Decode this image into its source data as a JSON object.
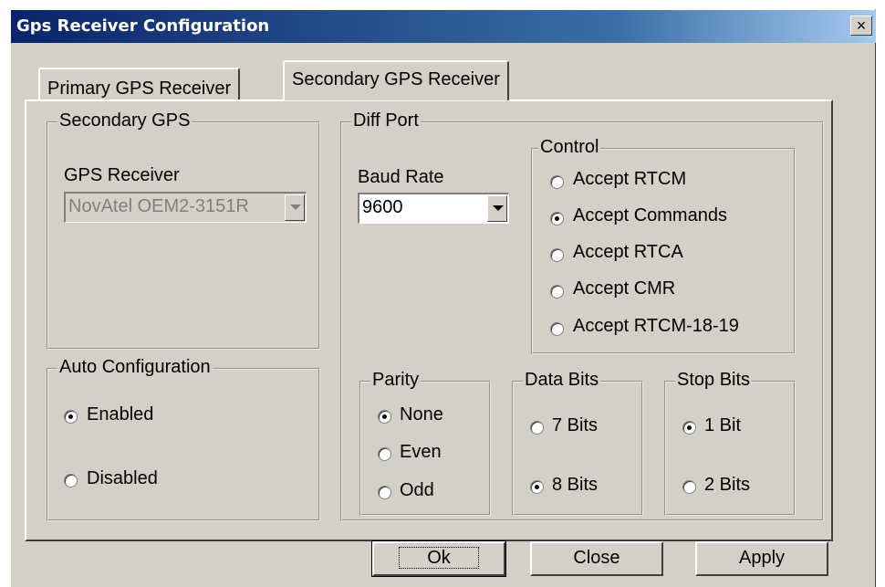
{
  "window": {
    "title": "Gps Receiver Configuration",
    "close_glyph": "×"
  },
  "tabs": [
    {
      "label": "Primary GPS Receiver",
      "active": false
    },
    {
      "label": "Secondary GPS Receiver",
      "active": true
    }
  ],
  "secondary_gps": {
    "legend": "Secondary GPS",
    "receiver_label": "GPS Receiver",
    "receiver_value": "NovAtel OEM2-3151R",
    "enabled": false
  },
  "auto_config": {
    "legend": "Auto Configuration",
    "options": [
      {
        "label": "Enabled",
        "checked": true
      },
      {
        "label": "Disabled",
        "checked": false
      }
    ]
  },
  "diff_port": {
    "legend": "Diff Port",
    "baud_label": "Baud Rate",
    "baud_value": "9600",
    "control": {
      "legend": "Control",
      "options": [
        {
          "label": "Accept RTCM",
          "checked": false
        },
        {
          "label": "Accept Commands",
          "checked": true
        },
        {
          "label": "Accept RTCA",
          "checked": false
        },
        {
          "label": "Accept CMR",
          "checked": false
        },
        {
          "label": "Accept RTCM-18-19",
          "checked": false
        }
      ]
    },
    "parity": {
      "legend": "Parity",
      "options": [
        {
          "label": "None",
          "checked": true
        },
        {
          "label": "Even",
          "checked": false
        },
        {
          "label": "Odd",
          "checked": false
        }
      ]
    },
    "data_bits": {
      "legend": "Data Bits",
      "options": [
        {
          "label": "7 Bits",
          "checked": false
        },
        {
          "label": "8 Bits",
          "checked": true
        }
      ]
    },
    "stop_bits": {
      "legend": "Stop Bits",
      "options": [
        {
          "label": "1 Bit",
          "checked": true
        },
        {
          "label": "2 Bits",
          "checked": false
        }
      ]
    }
  },
  "buttons": {
    "ok": "Ok",
    "close": "Close",
    "apply": "Apply"
  }
}
